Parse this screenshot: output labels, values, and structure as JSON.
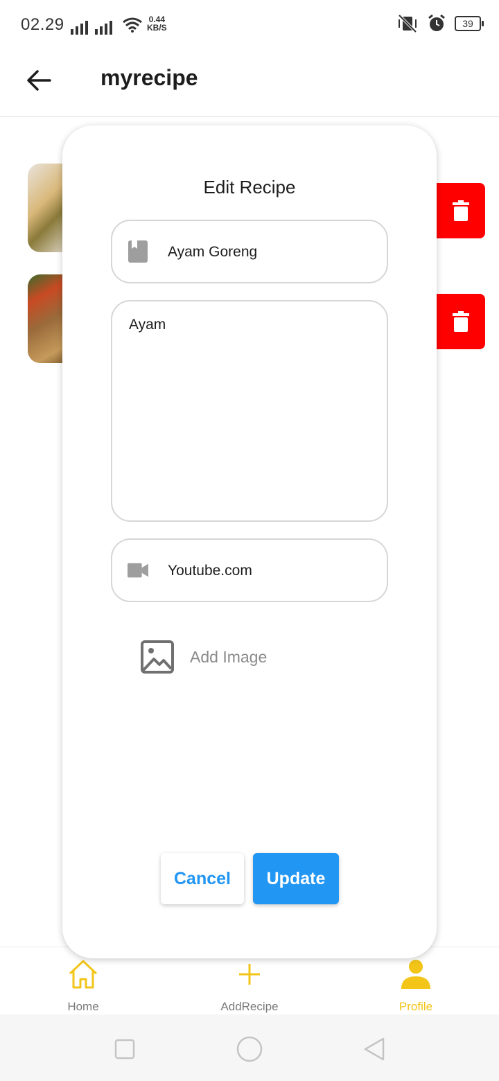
{
  "status_bar": {
    "time": "02.29",
    "net_speed_value": "0.44",
    "net_speed_unit": "KB/S",
    "battery": "39"
  },
  "app_bar": {
    "title": "myrecipe"
  },
  "dialog": {
    "title": "Edit Recipe",
    "name_value": "Ayam Goreng",
    "description_value": "Ayam",
    "video_value": "Youtube.com",
    "add_image_label": "Add Image",
    "cancel_label": "Cancel",
    "update_label": "Update"
  },
  "bottom_nav": {
    "items": [
      {
        "label": "Home",
        "icon": "home-icon"
      },
      {
        "label": "AddRecipe",
        "icon": "plus-icon"
      },
      {
        "label": "Profile",
        "icon": "person-icon"
      }
    ],
    "active_color": "#f2c518"
  },
  "colors": {
    "primary": "#2196F3",
    "delete": "#ff0000",
    "accent": "#f2c518"
  }
}
